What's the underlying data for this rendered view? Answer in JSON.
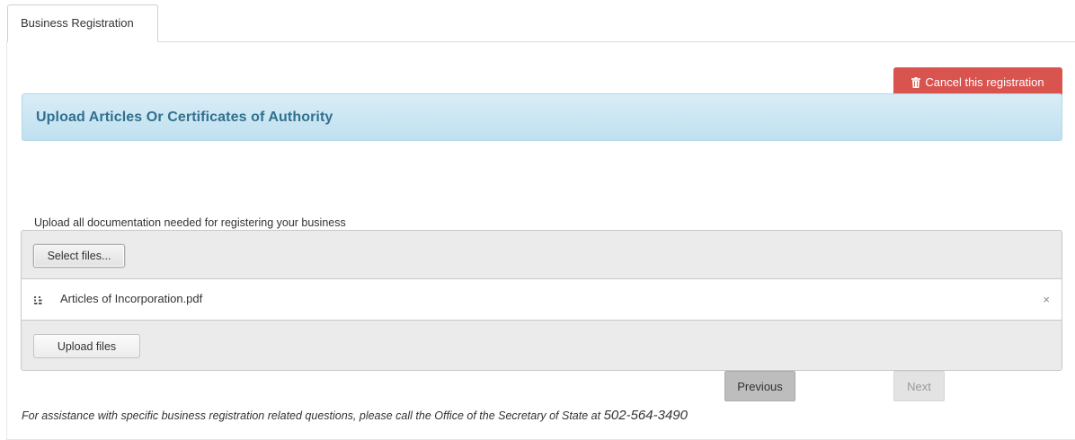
{
  "tabs": [
    {
      "label": "Business Registration",
      "selected": true
    }
  ],
  "cancel_button": {
    "label": "Cancel this registration",
    "icon": "trash-icon",
    "color": "#d9534f"
  },
  "section": {
    "title": "Upload Articles Or Certificates of Authority"
  },
  "upload": {
    "instruction": "Upload all documentation needed for registering your business",
    "select_label": "Select files...",
    "files": [
      {
        "name": "Articles of Incorporation.pdf",
        "remove_glyph": "×"
      }
    ],
    "upload_label": "Upload files"
  },
  "navigation": {
    "previous_label": "Previous",
    "next_label": "Next",
    "next_enabled": false
  },
  "footer": {
    "assist_text": "For assistance with specific business registration related questions, please call the Office of the Secretary of State at",
    "phone": "502-564-3490"
  }
}
